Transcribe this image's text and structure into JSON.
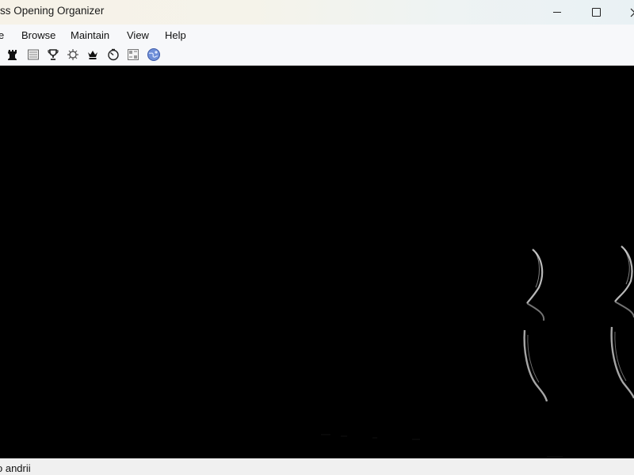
{
  "window": {
    "title": "ss Opening Organizer"
  },
  "menu": {
    "items": [
      "e",
      "Browse",
      "Maintain",
      "View",
      "Help"
    ]
  },
  "toolbar": {
    "icons": [
      "rook-icon",
      "notation-icon",
      "trophy-icon",
      "gear-board-icon",
      "queen-icon",
      "clock-icon",
      "scoresheet-icon",
      "globe-icon"
    ]
  },
  "status": {
    "text": "o andrii"
  },
  "colors": {
    "canvas_background": "#000000",
    "titlebar_background": "#f5f3ea",
    "menubar_background": "#f7f8fa"
  }
}
